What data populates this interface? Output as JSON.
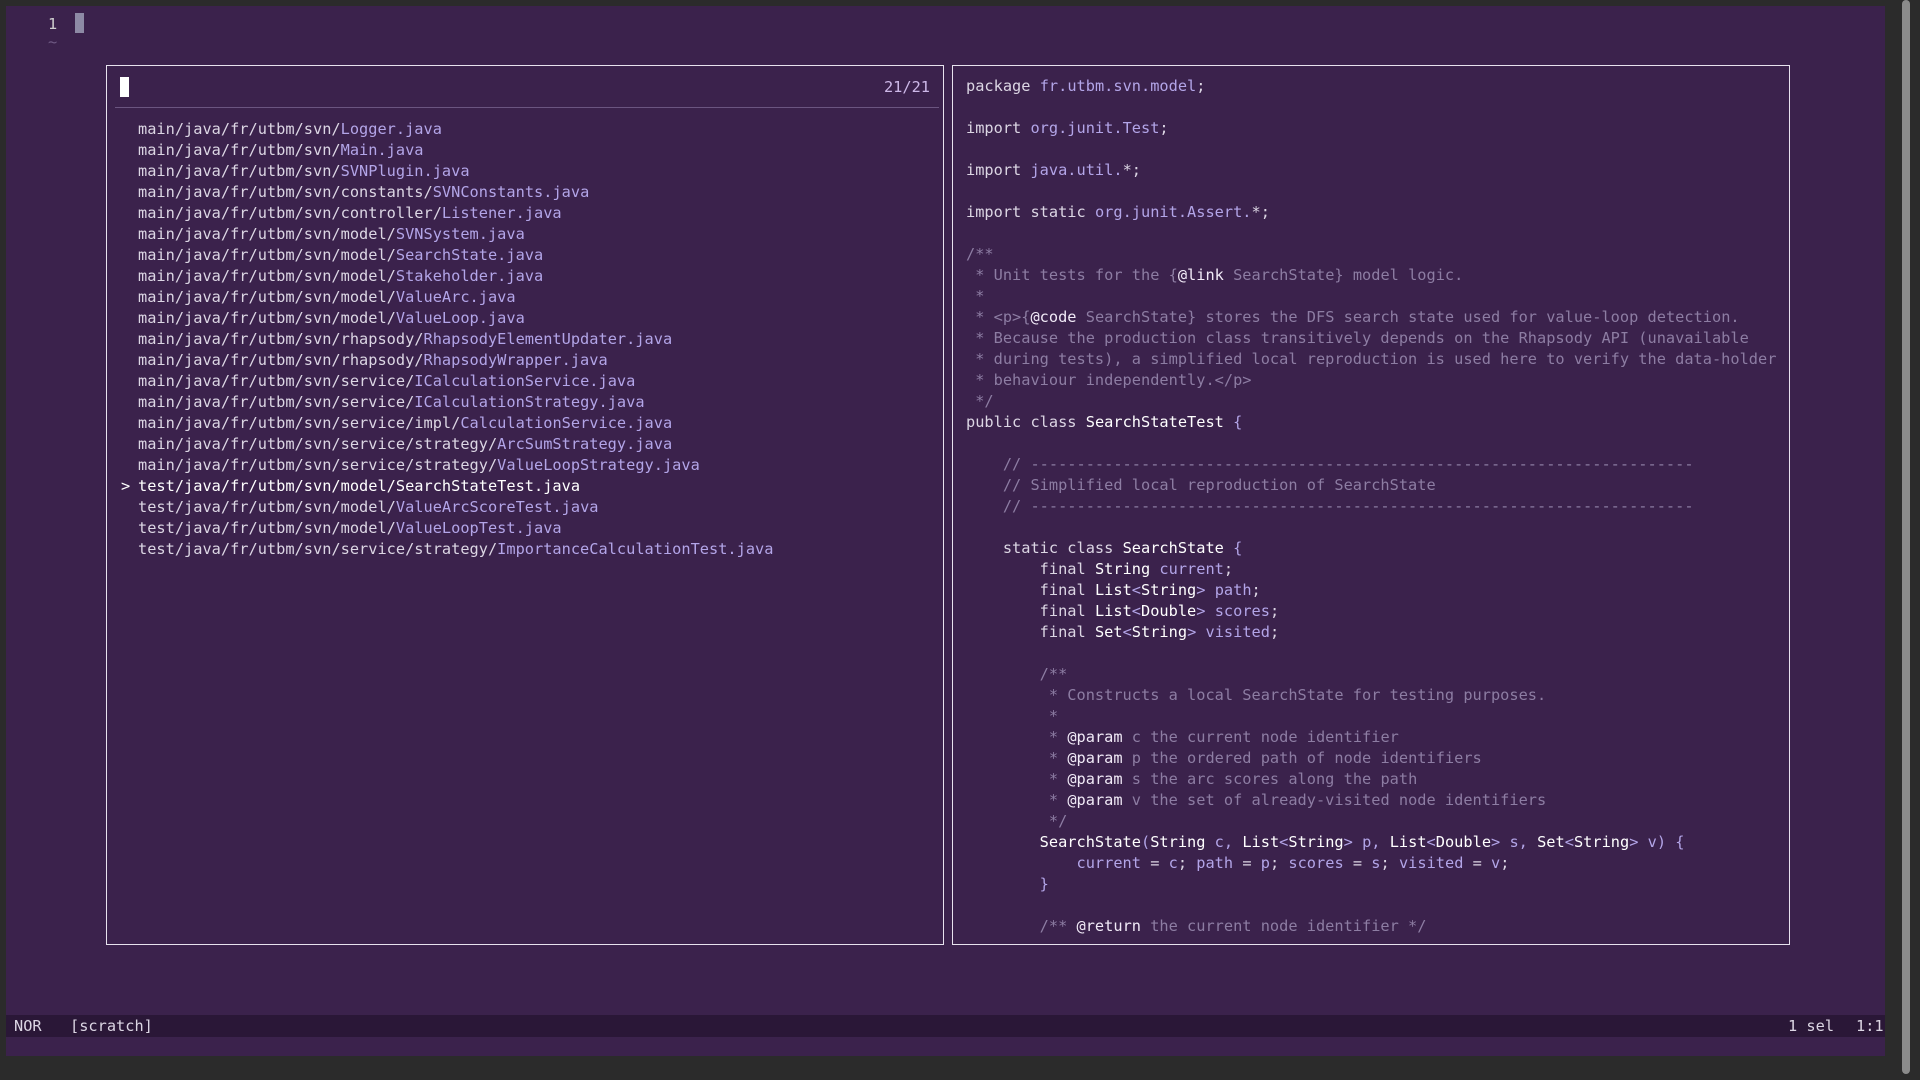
{
  "editor": {
    "line_number": "1",
    "empty_line_marker": "~"
  },
  "picker": {
    "counter": "21/21",
    "files": [
      {
        "dir": "main/java/fr/utbm/svn/",
        "name": "Logger.java",
        "selected": false
      },
      {
        "dir": "main/java/fr/utbm/svn/",
        "name": "Main.java",
        "selected": false
      },
      {
        "dir": "main/java/fr/utbm/svn/",
        "name": "SVNPlugin.java",
        "selected": false
      },
      {
        "dir": "main/java/fr/utbm/svn/constants/",
        "name": "SVNConstants.java",
        "selected": false
      },
      {
        "dir": "main/java/fr/utbm/svn/controller/",
        "name": "Listener.java",
        "selected": false
      },
      {
        "dir": "main/java/fr/utbm/svn/model/",
        "name": "SVNSystem.java",
        "selected": false
      },
      {
        "dir": "main/java/fr/utbm/svn/model/",
        "name": "SearchState.java",
        "selected": false
      },
      {
        "dir": "main/java/fr/utbm/svn/model/",
        "name": "Stakeholder.java",
        "selected": false
      },
      {
        "dir": "main/java/fr/utbm/svn/model/",
        "name": "ValueArc.java",
        "selected": false
      },
      {
        "dir": "main/java/fr/utbm/svn/model/",
        "name": "ValueLoop.java",
        "selected": false
      },
      {
        "dir": "main/java/fr/utbm/svn/rhapsody/",
        "name": "RhapsodyElementUpdater.java",
        "selected": false
      },
      {
        "dir": "main/java/fr/utbm/svn/rhapsody/",
        "name": "RhapsodyWrapper.java",
        "selected": false
      },
      {
        "dir": "main/java/fr/utbm/svn/service/",
        "name": "ICalculationService.java",
        "selected": false
      },
      {
        "dir": "main/java/fr/utbm/svn/service/",
        "name": "ICalculationStrategy.java",
        "selected": false
      },
      {
        "dir": "main/java/fr/utbm/svn/service/impl/",
        "name": "CalculationService.java",
        "selected": false
      },
      {
        "dir": "main/java/fr/utbm/svn/service/strategy/",
        "name": "ArcSumStrategy.java",
        "selected": false
      },
      {
        "dir": "main/java/fr/utbm/svn/service/strategy/",
        "name": "ValueLoopStrategy.java",
        "selected": false
      },
      {
        "dir": "test/java/fr/utbm/svn/model/",
        "name": "SearchStateTest.java",
        "selected": true
      },
      {
        "dir": "test/java/fr/utbm/svn/model/",
        "name": "ValueArcScoreTest.java",
        "selected": false
      },
      {
        "dir": "test/java/fr/utbm/svn/model/",
        "name": "ValueLoopTest.java",
        "selected": false
      },
      {
        "dir": "test/java/fr/utbm/svn/service/strategy/",
        "name": "ImportanceCalculationTest.java",
        "selected": false
      }
    ],
    "selection_marker": ">"
  },
  "preview": {
    "lines": [
      [
        [
          "kw",
          "package "
        ],
        [
          "nm",
          "fr.utbm.svn.model"
        ],
        [
          "kw",
          ";"
        ]
      ],
      [],
      [
        [
          "kw",
          "import "
        ],
        [
          "nm",
          "org.junit.Test"
        ],
        [
          "kw",
          ";"
        ]
      ],
      [],
      [
        [
          "kw",
          "import "
        ],
        [
          "nm",
          "java.util."
        ],
        [
          "kw",
          "*;"
        ]
      ],
      [],
      [
        [
          "kw",
          "import static "
        ],
        [
          "nm",
          "org.junit.Assert."
        ],
        [
          "kw",
          "*;"
        ]
      ],
      [],
      [
        [
          "cm",
          "/**"
        ]
      ],
      [
        [
          "cm",
          " * Unit tests for the {"
        ],
        [
          "tag",
          "@link"
        ],
        [
          "cm",
          " SearchState} model logic."
        ]
      ],
      [
        [
          "cm",
          " *"
        ]
      ],
      [
        [
          "cm",
          " * <p>{"
        ],
        [
          "tag",
          "@code"
        ],
        [
          "cm",
          " SearchState} stores the DFS search state used for value-loop detection."
        ]
      ],
      [
        [
          "cm",
          " * Because the production class transitively depends on the Rhapsody API (unavailable"
        ]
      ],
      [
        [
          "cm",
          " * during tests), a simplified local reproduction is used here to verify the data-holder"
        ]
      ],
      [
        [
          "cm",
          " * behaviour independently.</p>"
        ]
      ],
      [
        [
          "cm",
          " */"
        ]
      ],
      [
        [
          "kw",
          "public class "
        ],
        [
          "ty",
          "SearchStateTest"
        ],
        [
          "pu",
          " {"
        ]
      ],
      [],
      [
        [
          "cm",
          "    // ------------------------------------------------------------------------"
        ]
      ],
      [
        [
          "cm",
          "    // Simplified local reproduction of SearchState"
        ]
      ],
      [
        [
          "cm",
          "    // ------------------------------------------------------------------------"
        ]
      ],
      [],
      [
        [
          "kw",
          "    static class "
        ],
        [
          "ty",
          "SearchState"
        ],
        [
          "pu",
          " {"
        ]
      ],
      [
        [
          "kw",
          "        final "
        ],
        [
          "ty",
          "String"
        ],
        [
          "nm",
          " current"
        ],
        [
          "kw",
          ";"
        ]
      ],
      [
        [
          "kw",
          "        final "
        ],
        [
          "ty",
          "List"
        ],
        [
          "pu",
          "<"
        ],
        [
          "ty",
          "String"
        ],
        [
          "pu",
          "> "
        ],
        [
          "nm",
          "path"
        ],
        [
          "kw",
          ";"
        ]
      ],
      [
        [
          "kw",
          "        final "
        ],
        [
          "ty",
          "List"
        ],
        [
          "pu",
          "<"
        ],
        [
          "ty",
          "Double"
        ],
        [
          "pu",
          "> "
        ],
        [
          "nm",
          "scores"
        ],
        [
          "kw",
          ";"
        ]
      ],
      [
        [
          "kw",
          "        final "
        ],
        [
          "ty",
          "Set"
        ],
        [
          "pu",
          "<"
        ],
        [
          "ty",
          "String"
        ],
        [
          "pu",
          "> "
        ],
        [
          "nm",
          "visited"
        ],
        [
          "kw",
          ";"
        ]
      ],
      [],
      [
        [
          "cm",
          "        /**"
        ]
      ],
      [
        [
          "cm",
          "         * Constructs a local SearchState for testing purposes."
        ]
      ],
      [
        [
          "cm",
          "         *"
        ]
      ],
      [
        [
          "cm",
          "         * "
        ],
        [
          "tag",
          "@param"
        ],
        [
          "cm",
          " c the current node identifier"
        ]
      ],
      [
        [
          "cm",
          "         * "
        ],
        [
          "tag",
          "@param"
        ],
        [
          "cm",
          " p the ordered path of node identifiers"
        ]
      ],
      [
        [
          "cm",
          "         * "
        ],
        [
          "tag",
          "@param"
        ],
        [
          "cm",
          " s the arc scores along the path"
        ]
      ],
      [
        [
          "cm",
          "         * "
        ],
        [
          "tag",
          "@param"
        ],
        [
          "cm",
          " v the set of already-visited node identifiers"
        ]
      ],
      [
        [
          "cm",
          "         */"
        ]
      ],
      [
        [
          "ty",
          "        SearchState"
        ],
        [
          "pu",
          "("
        ],
        [
          "ty",
          "String"
        ],
        [
          "nm",
          " c"
        ],
        [
          "pu",
          ", "
        ],
        [
          "ty",
          "List"
        ],
        [
          "pu",
          "<"
        ],
        [
          "ty",
          "String"
        ],
        [
          "pu",
          "> "
        ],
        [
          "nm",
          "p"
        ],
        [
          "pu",
          ", "
        ],
        [
          "ty",
          "List"
        ],
        [
          "pu",
          "<"
        ],
        [
          "ty",
          "Double"
        ],
        [
          "pu",
          "> "
        ],
        [
          "nm",
          "s"
        ],
        [
          "pu",
          ", "
        ],
        [
          "ty",
          "Set"
        ],
        [
          "pu",
          "<"
        ],
        [
          "ty",
          "String"
        ],
        [
          "pu",
          "> "
        ],
        [
          "nm",
          "v"
        ],
        [
          "pu",
          ") {"
        ]
      ],
      [
        [
          "nm",
          "            current"
        ],
        [
          "kw",
          " = "
        ],
        [
          "nm",
          "c"
        ],
        [
          "kw",
          "; "
        ],
        [
          "nm",
          "path"
        ],
        [
          "kw",
          " = "
        ],
        [
          "nm",
          "p"
        ],
        [
          "kw",
          "; "
        ],
        [
          "nm",
          "scores"
        ],
        [
          "kw",
          " = "
        ],
        [
          "nm",
          "s"
        ],
        [
          "kw",
          "; "
        ],
        [
          "nm",
          "visited"
        ],
        [
          "kw",
          " = "
        ],
        [
          "nm",
          "v"
        ],
        [
          "kw",
          ";"
        ]
      ],
      [
        [
          "pu",
          "        }"
        ]
      ],
      [],
      [
        [
          "cm",
          "        /** "
        ],
        [
          "tag",
          "@return"
        ],
        [
          "cm",
          " the current node identifier */"
        ]
      ]
    ]
  },
  "statusbar": {
    "mode": "NOR",
    "buffer": "[scratch]",
    "selections": "1 sel",
    "position": "1:1"
  }
}
